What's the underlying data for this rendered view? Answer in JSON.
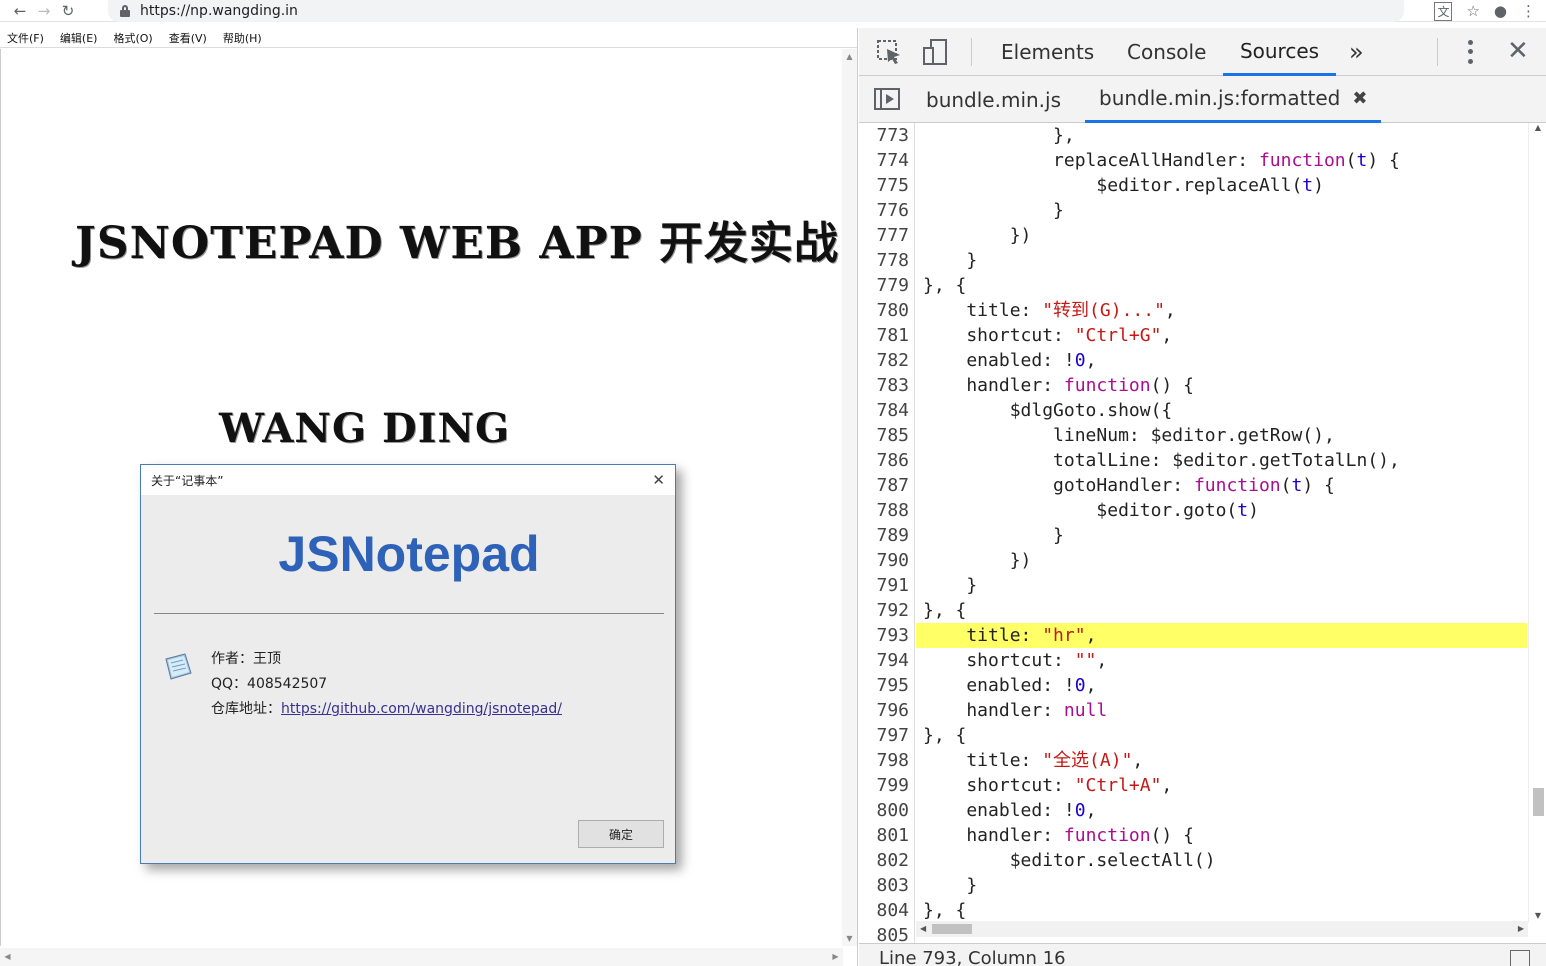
{
  "browser": {
    "url": "https://np.wangding.in",
    "icons": [
      "back-icon",
      "forward-icon",
      "reload-icon",
      "lock-icon",
      "translate-icon",
      "star-icon",
      "account-icon",
      "menu-icon"
    ]
  },
  "notepad": {
    "menu": [
      "文件(F)",
      "编辑(E)",
      "格式(O)",
      "查看(V)",
      "帮助(H)"
    ],
    "heading": "JSNOTEPAD WEB APP 开发实战",
    "author_heading": "WANG DING"
  },
  "about_dialog": {
    "title": "关于“记事本”",
    "app_name": "JSNotepad",
    "author_label": "作者：王顶",
    "qq_label": "QQ：408542507",
    "repo_label": "仓库地址：",
    "repo_link": "https://github.com/wangding/jsnotepad/",
    "ok_button": "确定"
  },
  "devtools": {
    "tabs": [
      "Elements",
      "Console",
      "Sources",
      "»"
    ],
    "active_tab": "Sources",
    "files": [
      "bundle.min.js",
      "bundle.min.js:formatted"
    ],
    "active_file": "bundle.min.js:formatted",
    "highlight_line": "793",
    "status": "Line 793, Column 16",
    "accent_color": "#1a73e8",
    "highlight_color": "#ffff66",
    "code_lines": [
      {
        "n": "773",
        "t": "            },"
      },
      {
        "n": "774",
        "t": "            replaceAllHandler: function(t) {"
      },
      {
        "n": "775",
        "t": "                $editor.replaceAll(t)"
      },
      {
        "n": "776",
        "t": "            }"
      },
      {
        "n": "777",
        "t": "        })"
      },
      {
        "n": "778",
        "t": "    }"
      },
      {
        "n": "779",
        "t": "}, {"
      },
      {
        "n": "780",
        "t": "    title: \"转到(G)...\","
      },
      {
        "n": "781",
        "t": "    shortcut: \"Ctrl+G\","
      },
      {
        "n": "782",
        "t": "    enabled: !0,"
      },
      {
        "n": "783",
        "t": "    handler: function() {"
      },
      {
        "n": "784",
        "t": "        $dlgGoto.show({"
      },
      {
        "n": "785",
        "t": "            lineNum: $editor.getRow(),"
      },
      {
        "n": "786",
        "t": "            totalLine: $editor.getTotalLn(),"
      },
      {
        "n": "787",
        "t": "            gotoHandler: function(t) {"
      },
      {
        "n": "788",
        "t": "                $editor.goto(t)"
      },
      {
        "n": "789",
        "t": "            }"
      },
      {
        "n": "790",
        "t": "        })"
      },
      {
        "n": "791",
        "t": "    }"
      },
      {
        "n": "792",
        "t": "}, {"
      },
      {
        "n": "793",
        "t": "    title: \"hr\","
      },
      {
        "n": "794",
        "t": "    shortcut: \"\","
      },
      {
        "n": "795",
        "t": "    enabled: !0,"
      },
      {
        "n": "796",
        "t": "    handler: null"
      },
      {
        "n": "797",
        "t": "}, {"
      },
      {
        "n": "798",
        "t": "    title: \"全选(A)\","
      },
      {
        "n": "799",
        "t": "    shortcut: \"Ctrl+A\","
      },
      {
        "n": "800",
        "t": "    enabled: !0,"
      },
      {
        "n": "801",
        "t": "    handler: function() {"
      },
      {
        "n": "802",
        "t": "        $editor.selectAll()"
      },
      {
        "n": "803",
        "t": "    }"
      },
      {
        "n": "804",
        "t": "}, {"
      },
      {
        "n": "805",
        "t": ""
      }
    ]
  }
}
